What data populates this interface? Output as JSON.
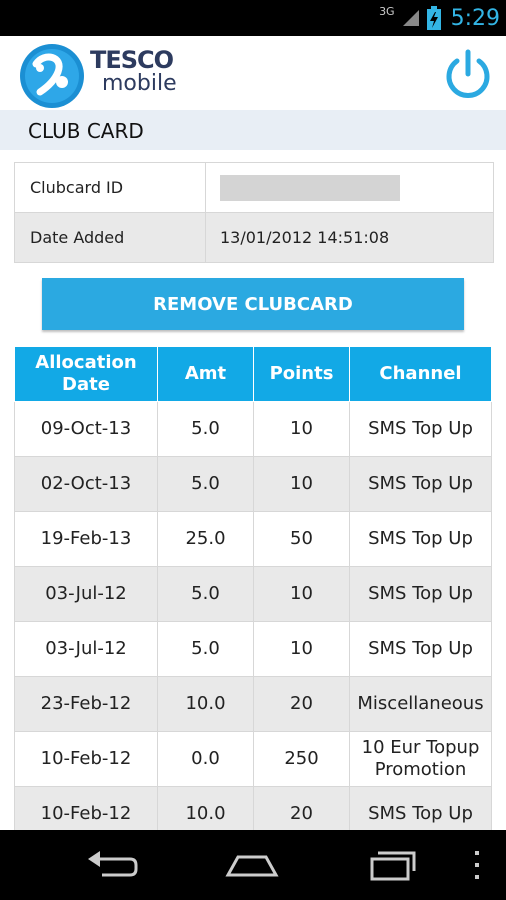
{
  "status_bar": {
    "network": "3G",
    "time": "5:29"
  },
  "header": {
    "brand_top": "TESCO",
    "brand_bottom": "mobile"
  },
  "page_title": "CLUB CARD",
  "info": {
    "rows": [
      {
        "label": "Clubcard ID",
        "value": ""
      },
      {
        "label": "Date Added",
        "value": "13/01/2012 14:51:08"
      }
    ]
  },
  "remove_button": "REMOVE CLUBCARD",
  "allocation_table": {
    "headers": [
      "Allocation Date",
      "Amt",
      "Points",
      "Channel"
    ],
    "rows": [
      [
        "09-Oct-13",
        "5.0",
        "10",
        "SMS Top Up"
      ],
      [
        "02-Oct-13",
        "5.0",
        "10",
        "SMS Top Up"
      ],
      [
        "19-Feb-13",
        "25.0",
        "50",
        "SMS Top Up"
      ],
      [
        "03-Jul-12",
        "5.0",
        "10",
        "SMS Top Up"
      ],
      [
        "03-Jul-12",
        "5.0",
        "10",
        "SMS Top Up"
      ],
      [
        "23-Feb-12",
        "10.0",
        "20",
        "Miscellaneous"
      ],
      [
        "10-Feb-12",
        "0.0",
        "250",
        "10 Eur Topup Promotion"
      ],
      [
        "10-Feb-12",
        "10.0",
        "20",
        "SMS Top Up"
      ]
    ]
  },
  "icons": {
    "logo": "tesco-mobile-logo",
    "power": "power-icon",
    "nav": [
      "back-icon",
      "home-icon",
      "recent-apps-icon",
      "overflow-menu-icon"
    ]
  },
  "colors": {
    "accent": "#12a9e6",
    "button": "#2ba9e1",
    "title_bg": "#e8eef5"
  }
}
